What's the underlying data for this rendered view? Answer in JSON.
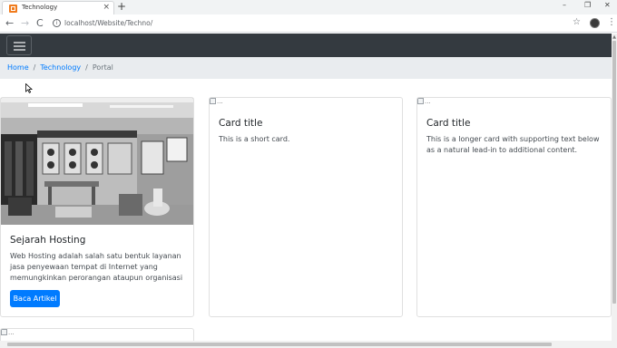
{
  "browser": {
    "tab_title": "Technology",
    "tab_close": "×",
    "new_tab": "+",
    "url": "localhost/Website/Techno/",
    "nav": {
      "back": "←",
      "forward": "→",
      "reload": "C"
    },
    "window_controls": {
      "minimize": "–",
      "maximize": "❐",
      "close": "✕"
    },
    "star": "☆",
    "menu": "⋮"
  },
  "breadcrumb": {
    "items": [
      {
        "label": "Home"
      },
      {
        "label": "Technology"
      },
      {
        "label": "Portal"
      }
    ],
    "separator": "/"
  },
  "cards": [
    {
      "title": "Sejarah Hosting",
      "text": "Web Hosting adalah salah satu bentuk layanan jasa penyewaan tempat di Internet yang memungkinkan perorangan ataupun organisasi",
      "button": "Baca Artikel"
    },
    {
      "image_alt": "...",
      "title": "Card title",
      "text": "This is a short card."
    },
    {
      "image_alt": "...",
      "title": "Card title",
      "text": "This is a longer card with supporting text below as a natural lead-in to additional content."
    },
    {
      "image_alt": "..."
    }
  ],
  "colors": {
    "navbar": "#343a40",
    "breadcrumb_bg": "#e9ecef",
    "link": "#007bff",
    "button": "#007bff"
  }
}
